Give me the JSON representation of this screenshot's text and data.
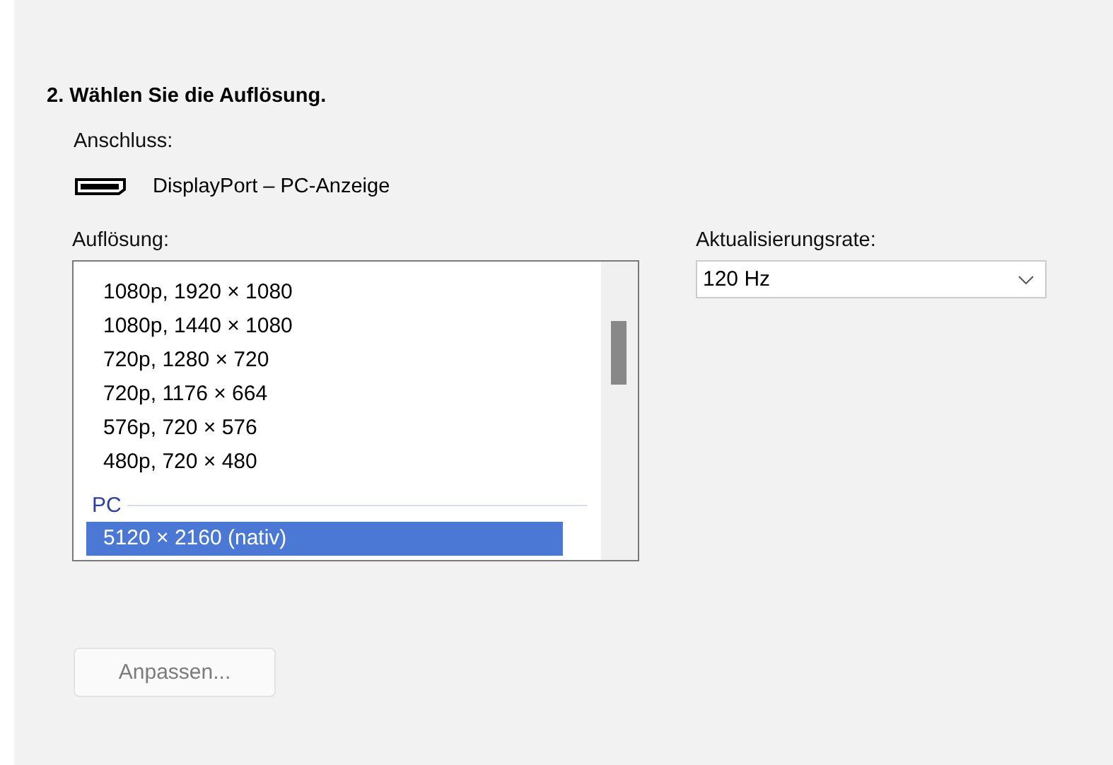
{
  "heading": "2. Wählen Sie die Auflösung.",
  "connection": {
    "label": "Anschluss:",
    "value": "DisplayPort – PC-Anzeige"
  },
  "resolution": {
    "label": "Auflösung:",
    "items": [
      {
        "kind": "item",
        "label": "1080p, 1920 × 1080",
        "selected": false
      },
      {
        "kind": "item",
        "label": "1080p, 1440 × 1080",
        "selected": false
      },
      {
        "kind": "item",
        "label": "720p, 1280 × 720",
        "selected": false
      },
      {
        "kind": "item",
        "label": "720p, 1176 × 664",
        "selected": false
      },
      {
        "kind": "item",
        "label": "576p, 720 × 576",
        "selected": false
      },
      {
        "kind": "item",
        "label": "480p, 720 × 480",
        "selected": false
      },
      {
        "kind": "group",
        "label": "PC"
      },
      {
        "kind": "item",
        "label": "5120 × 2160 (nativ)",
        "selected": true
      }
    ]
  },
  "refresh_rate": {
    "label": "Aktualisierungsrate:",
    "value": "120 Hz"
  },
  "customize_button": {
    "label": "Anpassen...",
    "disabled": true
  }
}
